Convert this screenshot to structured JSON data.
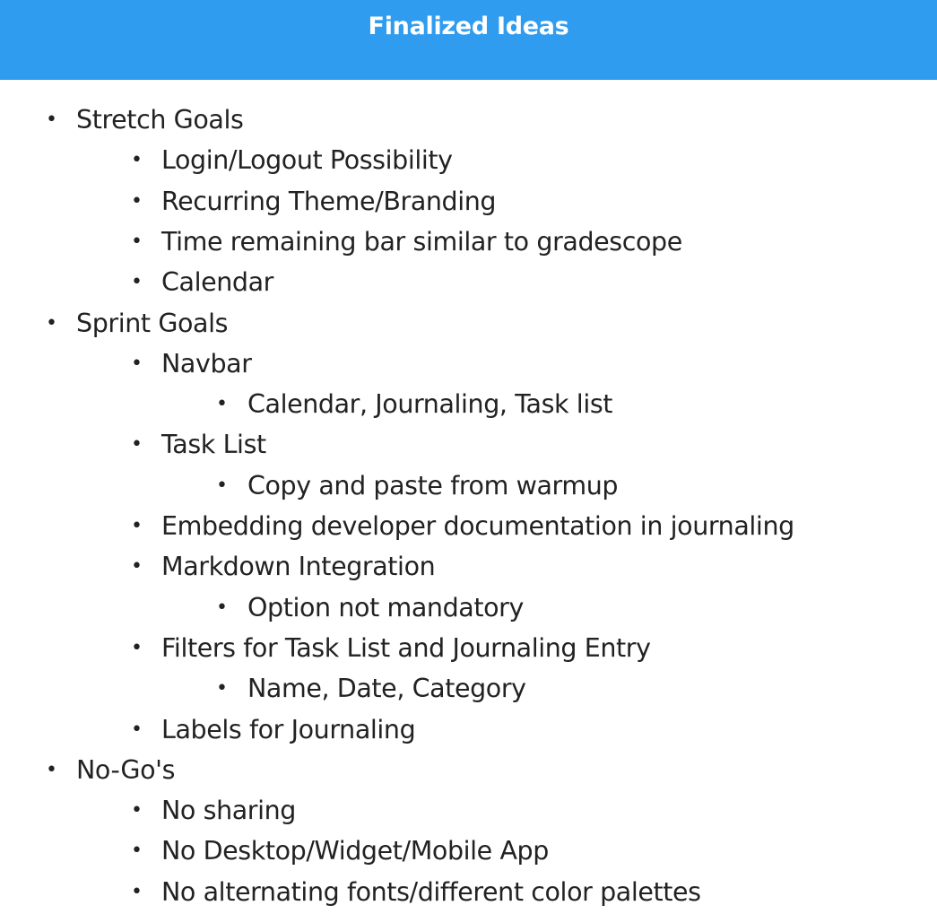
{
  "header": {
    "title": "Finalized Ideas",
    "background": "#2f9cf0"
  },
  "list": {
    "bullet": "•",
    "items": [
      {
        "level": 0,
        "text": "Stretch Goals"
      },
      {
        "level": 1,
        "text": "Login/Logout Possibility"
      },
      {
        "level": 1,
        "text": "Recurring Theme/Branding"
      },
      {
        "level": 1,
        "text": "Time remaining bar similar to gradescope"
      },
      {
        "level": 1,
        "text": "Calendar"
      },
      {
        "level": 0,
        "text": "Sprint Goals"
      },
      {
        "level": 1,
        "text": "Navbar"
      },
      {
        "level": 2,
        "text": "Calendar, Journaling, Task list"
      },
      {
        "level": 1,
        "text": "Task List"
      },
      {
        "level": 2,
        "text": "Copy and paste from warmup"
      },
      {
        "level": 1,
        "text": "Embedding developer documentation in journaling"
      },
      {
        "level": 1,
        "text": "Markdown Integration"
      },
      {
        "level": 2,
        "text": "Option not mandatory"
      },
      {
        "level": 1,
        "text": "Filters for Task List and Journaling Entry"
      },
      {
        "level": 2,
        "text": "Name, Date, Category"
      },
      {
        "level": 1,
        "text": "Labels for Journaling"
      },
      {
        "level": 0,
        "text": "No-Go's"
      },
      {
        "level": 1,
        "text": "No sharing"
      },
      {
        "level": 1,
        "text": "No Desktop/Widget/Mobile App"
      },
      {
        "level": 1,
        "text": "No alternating fonts/different color palettes"
      }
    ]
  }
}
